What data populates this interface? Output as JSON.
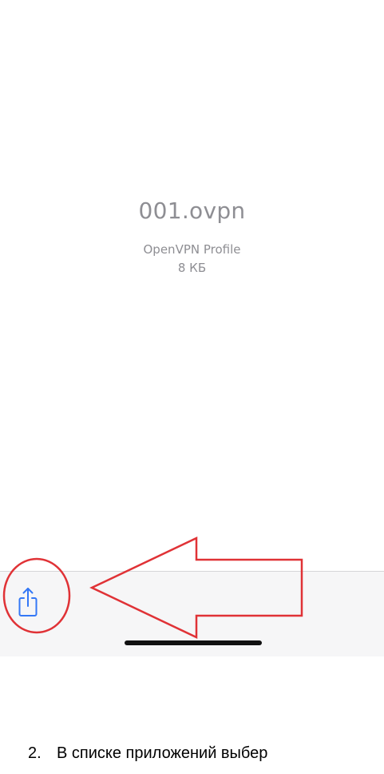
{
  "file": {
    "name": "001.ovpn",
    "type": "OpenVPN Profile",
    "size": "8 КБ"
  },
  "toolbar": {
    "share_icon": "share-icon"
  },
  "annotation": {
    "color": "#e03236",
    "shapes": [
      "circle",
      "arrow"
    ]
  },
  "instruction": {
    "number": "2.",
    "text": "В списке приложений выбер"
  },
  "colors": {
    "accent": "#3478f6",
    "muted_text": "#8e8e93",
    "toolbar_bg": "#f6f6f7"
  }
}
